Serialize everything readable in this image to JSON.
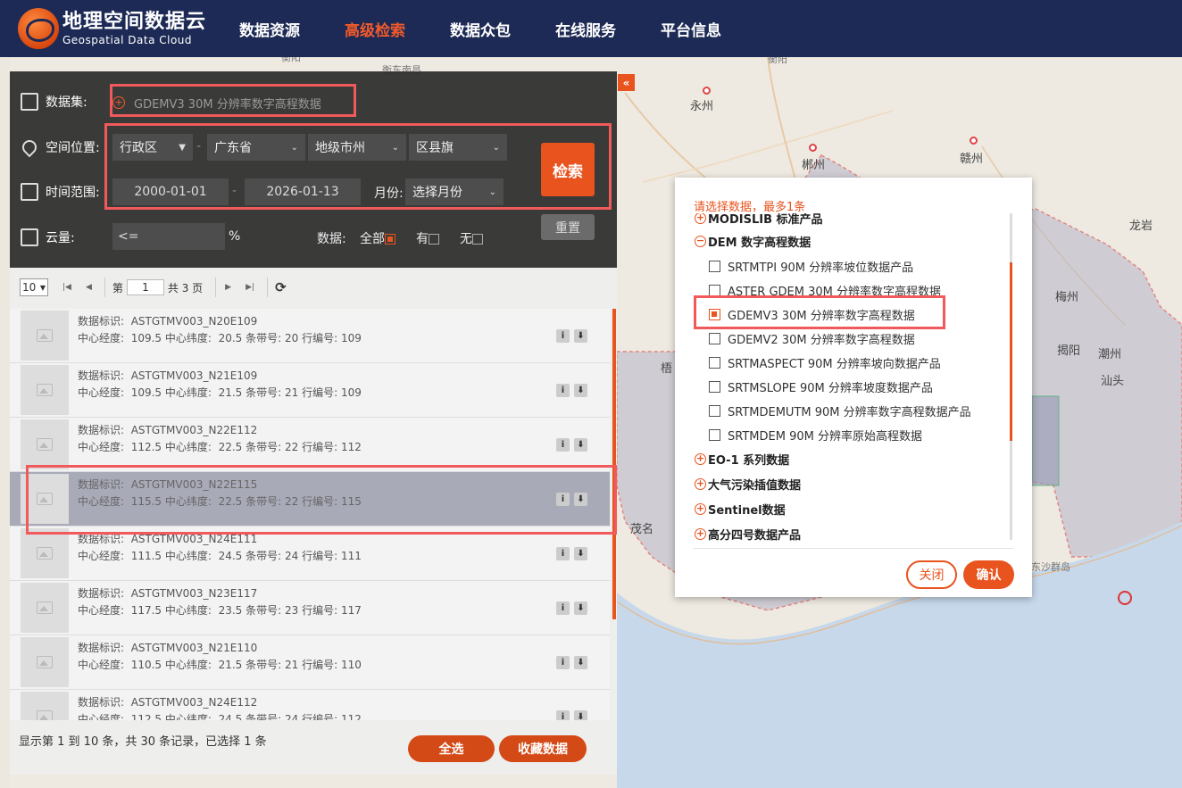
{
  "header": {
    "logo_cn": "地理空间数据云",
    "logo_en": "Geospatial Data Cloud",
    "nav": [
      "数据资源",
      "高级检索",
      "数据众包",
      "在线服务",
      "平台信息"
    ],
    "active_nav": "高级检索"
  },
  "map": {
    "labels": [
      "衡阳",
      "衡东南昌",
      "永州",
      "郴州",
      "赣州",
      "龙岩",
      "梅州",
      "揭阳",
      "潮州",
      "汕头",
      "梧",
      "茂名",
      "东沙群岛"
    ]
  },
  "search": {
    "dataset_label": "数据集:",
    "dataset_value": "GDEMV3 30M 分辨率数字高程数据",
    "location_label": "空间位置:",
    "region_type": "行政区",
    "province": "广东省",
    "city_placeholder": "地级市州",
    "county_placeholder": "区县旗",
    "time_label": "时间范围:",
    "start_date": "2000-01-01",
    "end_date": "2026-01-13",
    "month_label": "月份:",
    "month_placeholder": "选择月份",
    "cloud_label": "云量:",
    "cloud_op": "<=",
    "cloud_unit": "%",
    "data_label": "数据:",
    "opt_all": "全部",
    "opt_yes": "有",
    "opt_no": "无",
    "search_button": "检索",
    "reset_button": "重置",
    "dash": "-"
  },
  "pager": {
    "per_page": "10",
    "page_prefix": "第",
    "page_value": "1",
    "page_suffix": "共 3 页"
  },
  "results": [
    {
      "id": "ASTGTMV003_N20E109",
      "lon": "109.5",
      "lat": "20.5",
      "strip": "20",
      "row": "109",
      "selected": false
    },
    {
      "id": "ASTGTMV003_N21E109",
      "lon": "109.5",
      "lat": "21.5",
      "strip": "21",
      "row": "109",
      "selected": false
    },
    {
      "id": "ASTGTMV003_N22E112",
      "lon": "112.5",
      "lat": "22.5",
      "strip": "22",
      "row": "112",
      "selected": false
    },
    {
      "id": "ASTGTMV003_N22E115",
      "lon": "115.5",
      "lat": "22.5",
      "strip": "22",
      "row": "115",
      "selected": true
    },
    {
      "id": "ASTGTMV003_N24E111",
      "lon": "111.5",
      "lat": "24.5",
      "strip": "24",
      "row": "111",
      "selected": false
    },
    {
      "id": "ASTGTMV003_N23E117",
      "lon": "117.5",
      "lat": "23.5",
      "strip": "23",
      "row": "117",
      "selected": false
    },
    {
      "id": "ASTGTMV003_N21E110",
      "lon": "110.5",
      "lat": "21.5",
      "strip": "21",
      "row": "110",
      "selected": false
    },
    {
      "id": "ASTGTMV003_N24E112",
      "lon": "112.5",
      "lat": "24.5",
      "strip": "24",
      "row": "112",
      "selected": false
    }
  ],
  "result_labels": {
    "id_label": "数据标识:",
    "lon_label": "中心经度:",
    "lat_label": "中心纬度:",
    "strip_label": "条带号:",
    "row_label": "行编号:",
    "info_icon": "i",
    "download_icon": "⬇"
  },
  "footer": {
    "summary": "显示第 1 到 10 条，共 30 条记录，已选择 1 条",
    "select_all": "全选",
    "favorite": "收藏数据"
  },
  "dialog": {
    "prompt": "请选择数据，最多1条",
    "tree": [
      {
        "kind": "node",
        "label": "MODISLIB 标准产品",
        "toggle": "+"
      },
      {
        "kind": "node",
        "label": "DEM 数字高程数据",
        "toggle": "−"
      },
      {
        "kind": "leaf",
        "label": "SRTMTPI 90M 分辨率坡位数据产品",
        "checked": false
      },
      {
        "kind": "leaf",
        "label": "ASTER GDEM 30M 分辨率数字高程数据",
        "checked": false
      },
      {
        "kind": "leaf",
        "label": "GDEMV3 30M 分辨率数字高程数据",
        "checked": true
      },
      {
        "kind": "leaf",
        "label": "GDEMV2 30M 分辨率数字高程数据",
        "checked": false
      },
      {
        "kind": "leaf",
        "label": "SRTMASPECT 90M 分辨率坡向数据产品",
        "checked": false
      },
      {
        "kind": "leaf",
        "label": "SRTMSLOPE 90M 分辨率坡度数据产品",
        "checked": false
      },
      {
        "kind": "leaf",
        "label": "SRTMDEMUTM 90M 分辨率数字高程数据产品",
        "checked": false
      },
      {
        "kind": "leaf",
        "label": "SRTMDEM 90M 分辨率原始高程数据",
        "checked": false
      },
      {
        "kind": "node",
        "label": "EO-1 系列数据",
        "toggle": "+"
      },
      {
        "kind": "node",
        "label": "大气污染插值数据",
        "toggle": "+"
      },
      {
        "kind": "node",
        "label": "Sentinel数据",
        "toggle": "+"
      },
      {
        "kind": "node",
        "label": "高分四号数据产品",
        "toggle": "+"
      }
    ],
    "close_button": "关闭",
    "confirm_button": "确认"
  },
  "colors": {
    "header_bg": "#1d2a55",
    "accent": "#e8531e",
    "highlight_box": "#f05a5a"
  }
}
